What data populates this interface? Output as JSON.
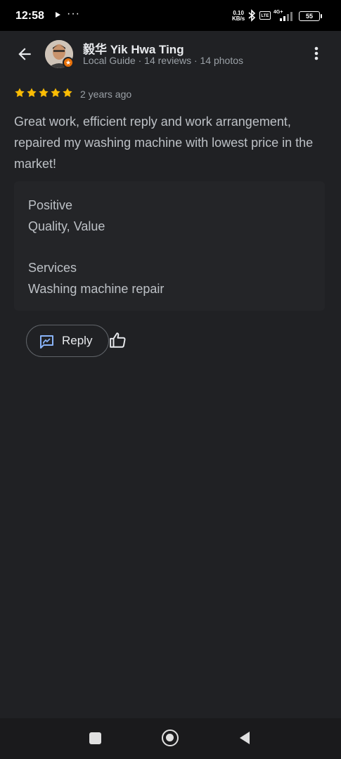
{
  "status_bar": {
    "time": "12:58",
    "network_speed": "0.10",
    "network_speed_unit": "KB/s",
    "network_type": "4G+",
    "lte_label": "LTE",
    "battery": "55"
  },
  "reviewer": {
    "name": "毅华 Yik Hwa Ting",
    "meta": "Local Guide · 14 reviews · 14 photos"
  },
  "review": {
    "rating": 5,
    "date": "2 years ago",
    "text": "Great work, efficient reply and work arrangement, repaired my washing machine with lowest price in the market!"
  },
  "attributes": [
    {
      "heading": "Positive",
      "value": "Quality, Value"
    },
    {
      "heading": "Services",
      "value": "Washing machine repair"
    }
  ],
  "actions": {
    "reply_label": "Reply"
  },
  "colors": {
    "background": "#202124",
    "star": "#fbbc04",
    "accent_blue": "#8ab4f8",
    "badge_orange": "#e8710a"
  },
  "icons": {
    "back": "arrow-left-icon",
    "more": "more-vert-icon",
    "reply": "reply-icon",
    "like": "thumb-up-icon",
    "badge": "local-guide-star-icon"
  }
}
